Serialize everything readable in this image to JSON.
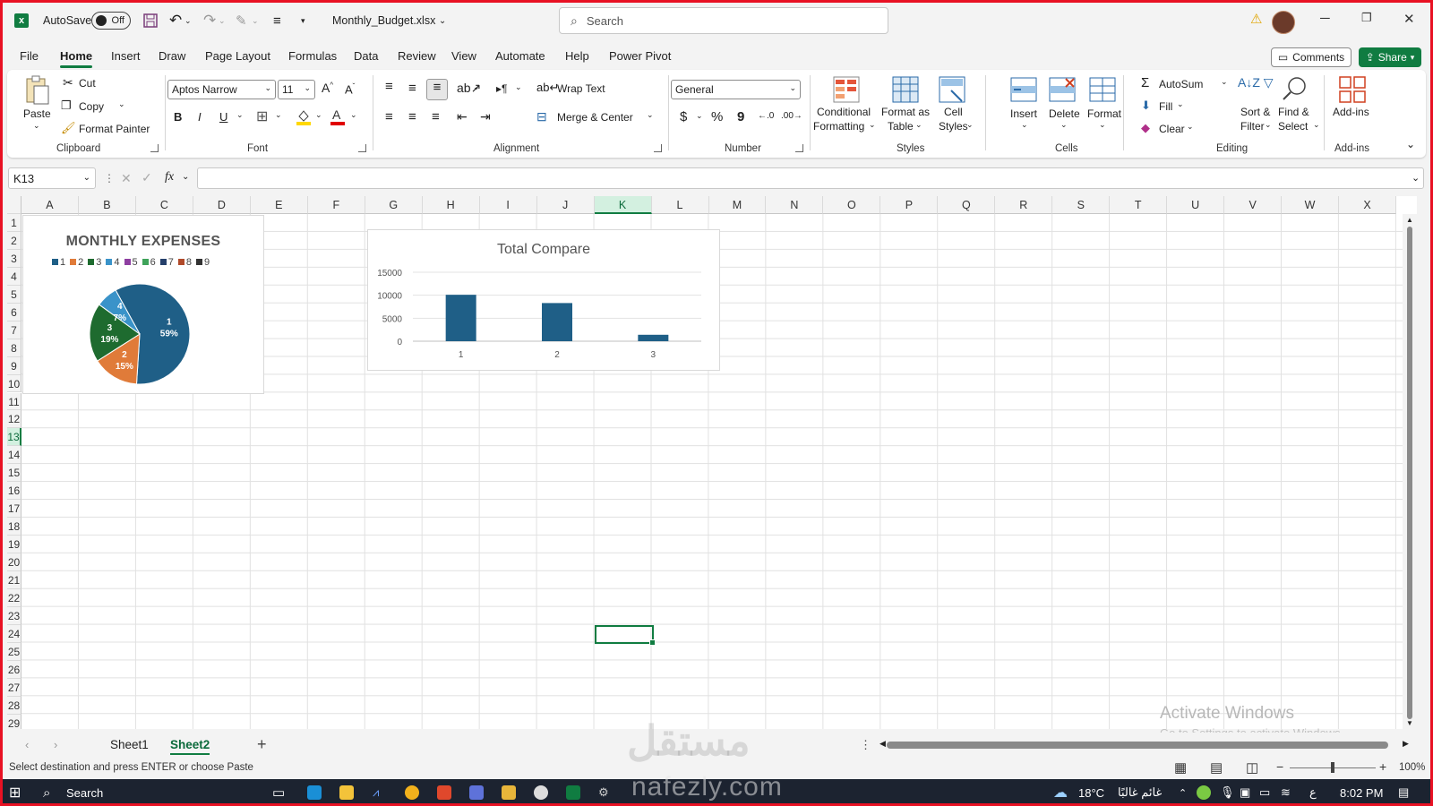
{
  "titlebar": {
    "autosave_label": "AutoSave",
    "autosave_state": "Off",
    "filename": "Monthly_Budget.xlsx",
    "search_placeholder": "Search"
  },
  "tabs": [
    "File",
    "Home",
    "Insert",
    "Draw",
    "Page Layout",
    "Formulas",
    "Data",
    "Review",
    "View",
    "Automate",
    "Help",
    "Power Pivot"
  ],
  "active_tab": "Home",
  "actions": {
    "comments": "Comments",
    "share": "Share"
  },
  "ribbon": {
    "clipboard": {
      "paste": "Paste",
      "cut": "Cut",
      "copy": "Copy",
      "format_painter": "Format Painter",
      "label": "Clipboard"
    },
    "font": {
      "name": "Aptos Narrow",
      "size": "11",
      "bold": "B",
      "italic": "I",
      "underline": "U",
      "label": "Font"
    },
    "alignment": {
      "wrap_text": "Wrap Text",
      "merge_center": "Merge & Center",
      "label": "Alignment"
    },
    "number": {
      "format": "General",
      "currency": "$",
      "percent": "%",
      "comma": "9",
      "label": "Number"
    },
    "styles": {
      "conditional1": "Conditional",
      "conditional2": "Formatting",
      "format_table1": "Format as",
      "format_table2": "Table",
      "cell_styles1": "Cell",
      "cell_styles2": "Styles",
      "label": "Styles"
    },
    "cells": {
      "insert": "Insert",
      "delete": "Delete",
      "format": "Format",
      "label": "Cells"
    },
    "editing": {
      "autosum": "AutoSum",
      "fill": "Fill",
      "clear": "Clear",
      "sort1": "Sort &",
      "sort2": "Filter",
      "find1": "Find &",
      "find2": "Select",
      "label": "Editing"
    },
    "addins": {
      "addins": "Add-ins",
      "label": "Add-ins"
    }
  },
  "formula_bar": {
    "name_box": "K13",
    "fx": "fx",
    "value": ""
  },
  "grid": {
    "columns": [
      "A",
      "B",
      "C",
      "D",
      "E",
      "F",
      "G",
      "H",
      "I",
      "J",
      "K",
      "L",
      "M",
      "N",
      "O",
      "P",
      "Q",
      "R",
      "S",
      "T",
      "U",
      "V",
      "W",
      "X"
    ],
    "rows": [
      "1",
      "2",
      "3",
      "4",
      "5",
      "6",
      "7",
      "8",
      "9",
      "10",
      "11",
      "12",
      "13",
      "14",
      "15",
      "16",
      "17",
      "18",
      "19",
      "20",
      "21",
      "22",
      "23",
      "24",
      "25",
      "26",
      "27",
      "28",
      "29"
    ],
    "selected_cell": "K13"
  },
  "chart_data": [
    {
      "type": "pie",
      "title": "MONTHLY EXPENSES",
      "legend": [
        "1",
        "2",
        "3",
        "4",
        "5",
        "6",
        "7",
        "8",
        "9"
      ],
      "legend_colors": [
        "#1f5f87",
        "#e07b39",
        "#1e6b2f",
        "#3a93c9",
        "#8e3fa1",
        "#3fa35a",
        "#25406b",
        "#b04a2a",
        "#333333"
      ],
      "slices": [
        {
          "label": "1",
          "percent": "59%",
          "value": 59,
          "color": "#1f5f87"
        },
        {
          "label": "2",
          "percent": "15%",
          "value": 15,
          "color": "#e07b39"
        },
        {
          "label": "3",
          "percent": "19%",
          "value": 19,
          "color": "#1e6b2f"
        },
        {
          "label": "4",
          "percent": "7%",
          "value": 7,
          "color": "#3a93c9"
        }
      ]
    },
    {
      "type": "bar",
      "title": "Total Compare",
      "categories": [
        "1",
        "2",
        "3"
      ],
      "values": [
        10100,
        8300,
        1400
      ],
      "ylim": [
        0,
        15000
      ],
      "yticks": [
        "15000",
        "10000",
        "5000",
        "0"
      ],
      "color": "#1f5f87",
      "grid": true
    }
  ],
  "sheets": [
    "Sheet1",
    "Sheet2"
  ],
  "active_sheet": "Sheet2",
  "status": {
    "message": "Select destination and press ENTER or choose Paste",
    "zoom": "100%"
  },
  "watermark": {
    "line1": "Activate Windows",
    "line2": "Go to Settings to activate Windows.",
    "logo": "مستقل",
    "url": "nafezly.com"
  },
  "taskbar": {
    "search": "Search",
    "weather": "18°C",
    "weather_text": "غائم غالبًا",
    "lang": "ع",
    "time": "8:02 PM"
  },
  "colors": {
    "excel_green": "#107c41",
    "accent_red": "#e81123"
  }
}
